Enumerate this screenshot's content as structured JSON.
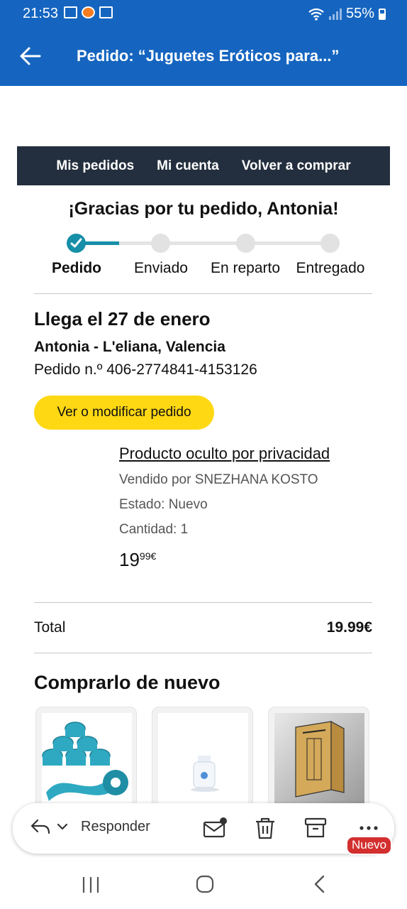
{
  "status_bar": {
    "time": "21:53",
    "battery": "55%",
    "notification_icons": [
      "font-icon",
      "app-icon",
      "gallery-icon"
    ]
  },
  "app_bar": {
    "title": "Pedido: “Juguetes Eróticos para...”",
    "back_icon": "arrow-left-icon",
    "color": "#1565c0"
  },
  "nav": {
    "items": [
      {
        "label": "Mis pedidos"
      },
      {
        "label": "Mi cuenta"
      },
      {
        "label": "Volver a comprar"
      }
    ],
    "background": "#232f3e"
  },
  "greeting": "¡Gracias por tu pedido, Antonia!",
  "progress": {
    "steps": [
      {
        "label": "Pedido",
        "done": true
      },
      {
        "label": "Enviado",
        "done": false
      },
      {
        "label": "En reparto",
        "done": false
      },
      {
        "label": "Entregado",
        "done": false
      }
    ],
    "accent": "#168fa8"
  },
  "order": {
    "arrival": "Llega el 27 de enero",
    "address": "Antonia - L'eliana, Valencia",
    "number": "Pedido n.º 406-2774841-4153126",
    "view_button": "Ver o modificar pedido"
  },
  "product": {
    "name": "Producto oculto por privacidad",
    "seller": "Vendido por SNEZHANA KOSTO",
    "condition": "Estado: Nuevo",
    "quantity": "Cantidad: 1",
    "price_whole": "19",
    "price_fraction": "99€"
  },
  "total": {
    "label": "Total",
    "value": "19.99€"
  },
  "rebuy": {
    "title": "Comprarlo de nuevo",
    "items": [
      {
        "image": "kinesiology-tape-rolls"
      },
      {
        "image": "small-white-bottle"
      },
      {
        "image": "paper-roll-box"
      }
    ]
  },
  "action_bar": {
    "reply_label": "Responder",
    "badge": "Nuevo",
    "icons": [
      "reply-icon",
      "mark-unread-icon",
      "trash-icon",
      "archive-icon",
      "more-icon"
    ]
  }
}
